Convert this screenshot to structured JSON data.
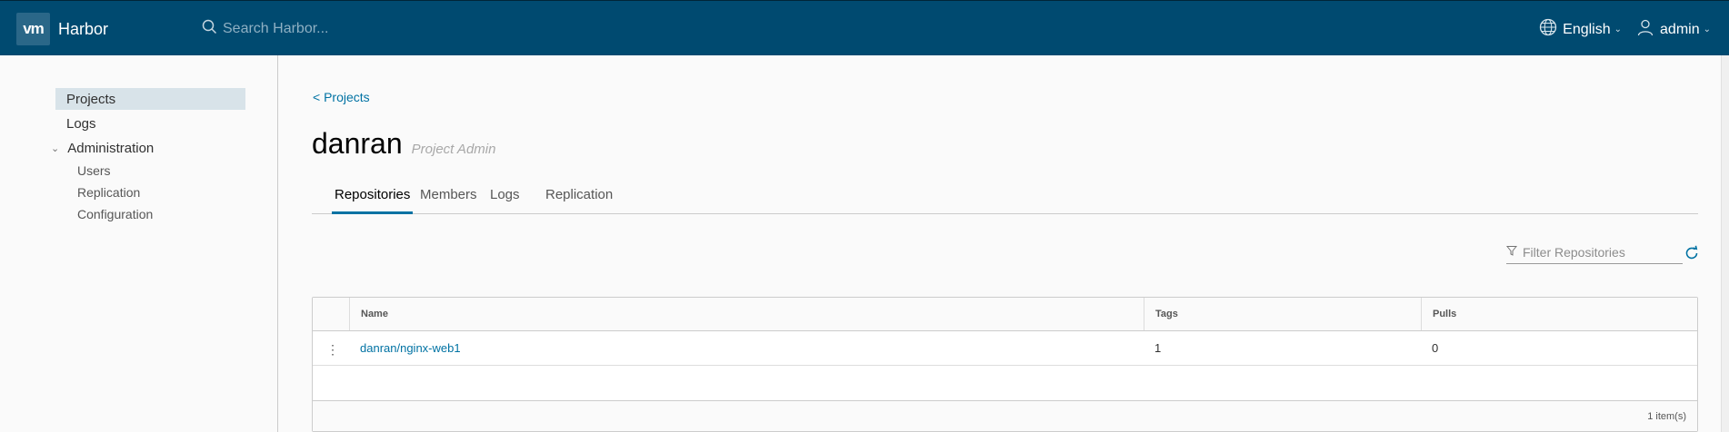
{
  "header": {
    "logo_text": "vm",
    "brand": "Harbor",
    "search_placeholder": "Search Harbor...",
    "language": "English",
    "user": "admin"
  },
  "sidebar": {
    "projects": "Projects",
    "logs": "Logs",
    "administration": "Administration",
    "admin_items": [
      "Users",
      "Replication",
      "Configuration"
    ]
  },
  "main": {
    "back_link": "< Projects",
    "project_name": "danran",
    "role": "Project Admin",
    "tabs": [
      "Repositories",
      "Members",
      "Logs",
      "Replication"
    ],
    "filter_placeholder": "Filter Repositories",
    "columns": [
      "Name",
      "Tags",
      "Pulls"
    ],
    "rows": [
      {
        "name": "danran/nginx-web1",
        "tags": "1",
        "pulls": "0"
      }
    ],
    "footer": "1 item(s)"
  },
  "colors": {
    "header_bg": "#004a70",
    "accent": "#0072a3",
    "selected_nav": "#d8e3e9"
  }
}
